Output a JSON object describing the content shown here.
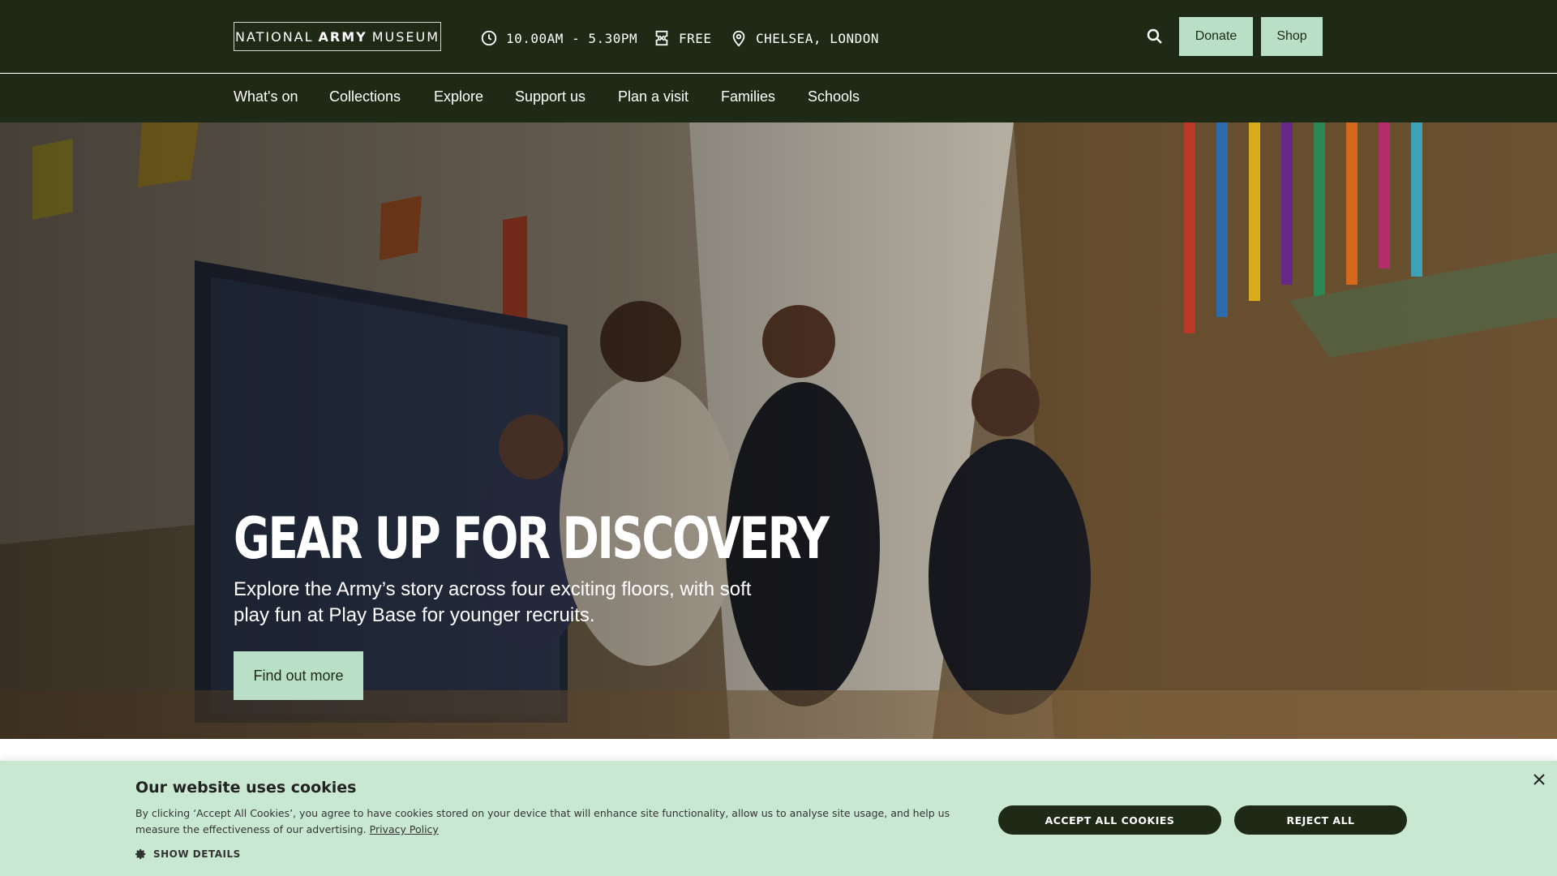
{
  "header": {
    "logo": {
      "part1": "NATIONAL",
      "part2": "ARMY",
      "part3": "MUSEUM"
    },
    "hours": "10.00AM - 5.30PM",
    "admission": "FREE",
    "location": "CHELSEA, LONDON",
    "donate_label": "Donate",
    "shop_label": "Shop",
    "icons": [
      "clock-icon",
      "ticket-icon",
      "location-pin-icon",
      "search-icon"
    ]
  },
  "nav": {
    "items": [
      {
        "label": "What's on"
      },
      {
        "label": "Collections"
      },
      {
        "label": "Explore"
      },
      {
        "label": "Support us"
      },
      {
        "label": "Plan a visit"
      },
      {
        "label": "Families"
      },
      {
        "label": "Schools"
      }
    ]
  },
  "hero": {
    "title": "GEAR UP FOR DISCOVERY",
    "description": "Explore the Army’s story across four exciting floors, with soft play fun at Play Base for younger recruits.",
    "cta_label": "Find out more"
  },
  "cookie_banner": {
    "title": "Our website uses cookies",
    "text": "By clicking ‘Accept All Cookies’, you agree to have cookies stored on your device that will enhance site functionality, allow us to analyse site usage, and help us measure the effectiveness of our advertising.",
    "privacy_link": "Privacy Policy",
    "show_details": "SHOW DETAILS",
    "accept_label": "ACCEPT ALL COOKIES",
    "reject_label": "REJECT ALL"
  },
  "colors": {
    "header_bg": "#1e2a15",
    "accent_button": "#b9dfc6",
    "cookie_bg": "#c9e8d2"
  }
}
